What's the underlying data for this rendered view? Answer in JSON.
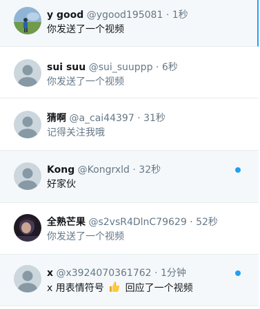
{
  "conversations": [
    {
      "name": "y good",
      "handle": "@ygood195081",
      "time": "1秒",
      "preview": "你发送了一个视频"
    },
    {
      "name": "sui suu",
      "handle": "@sui_suuppp",
      "time": "6秒",
      "preview": "你发送了一个视频"
    },
    {
      "name": "猜啊",
      "handle": "@a_cai44397",
      "time": "31秒",
      "preview": "记得关注我哦"
    },
    {
      "name": "Kong",
      "handle": "@Kongrxld",
      "time": "32秒",
      "preview": "好家伙"
    },
    {
      "name": "全熟芒果",
      "handle": "@s2vsR4DlnC79629",
      "time": "52秒",
      "preview": "你发送了一个视频"
    },
    {
      "name": "x",
      "handle": "@x3924070361762",
      "time": "1分钟",
      "preview_prefix": "x 用表情符号",
      "preview_suffix": "回应了一个视频",
      "reaction_icon": "thumbs-up-emoji-icon"
    }
  ],
  "separator": " · ",
  "colors": {
    "accent": "#1da1f2",
    "selected_bg": "#f5f8fa",
    "name": "#14171a",
    "meta": "#657786"
  }
}
